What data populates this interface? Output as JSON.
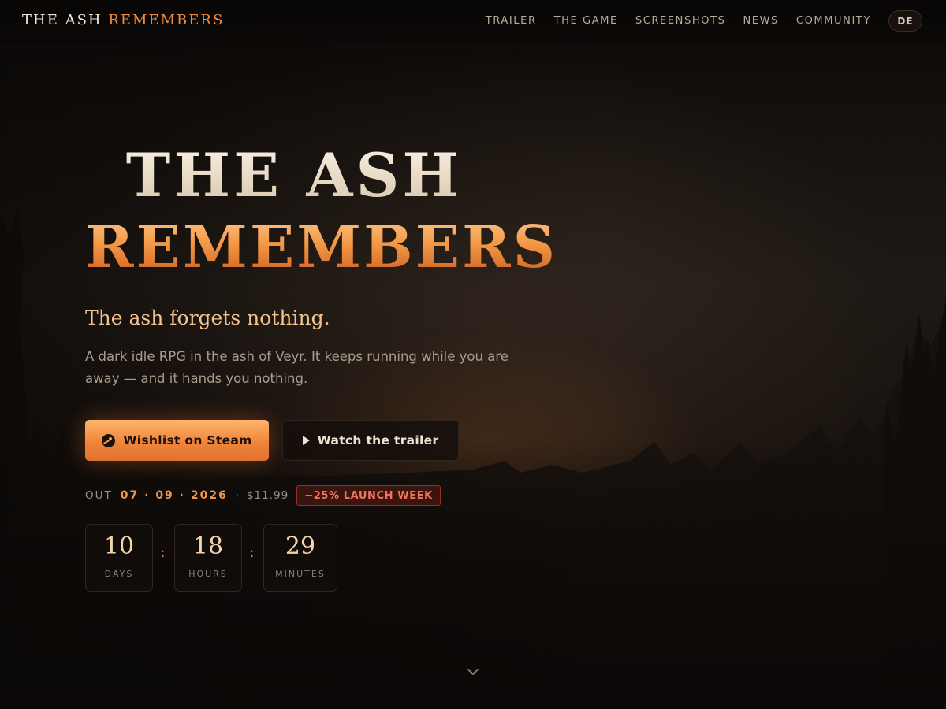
{
  "brand": {
    "word1": "THE ASH",
    "word2": "REMEMBERS"
  },
  "nav": {
    "items": [
      {
        "label": "TRAILER"
      },
      {
        "label": "THE GAME"
      },
      {
        "label": "SCREENSHOTS"
      },
      {
        "label": "NEWS"
      },
      {
        "label": "COMMUNITY"
      }
    ],
    "language": "DE"
  },
  "hero": {
    "title_line1": "THE ASH",
    "title_line2": "REMEMBERS",
    "tagline": "The ash forgets nothing.",
    "description": "A dark idle RPG in the ash of Veyr. It keeps running while you are away — and it hands you nothing."
  },
  "buttons": {
    "wishlist": {
      "label": "Wishlist on Steam",
      "icon": "steam-icon"
    },
    "trailer": {
      "label": "Watch the trailer",
      "icon": "play-icon"
    }
  },
  "release": {
    "out_label": "OUT",
    "date": "07 · 09 · 2026",
    "separator": "·",
    "price": "$11.99",
    "discount_badge": "−25% LAUNCH WEEK"
  },
  "countdown": {
    "units": [
      {
        "value": "10",
        "label": "DAYS"
      },
      {
        "value": "18",
        "label": "HOURS"
      },
      {
        "value": "29",
        "label": "MINUTES"
      }
    ],
    "separator": ":"
  },
  "scroll": {
    "icon": "chevron-down-icon"
  },
  "colors": {
    "accent": "#f08a3c",
    "background": "#0d0907",
    "badge_red": "#f2735c"
  }
}
